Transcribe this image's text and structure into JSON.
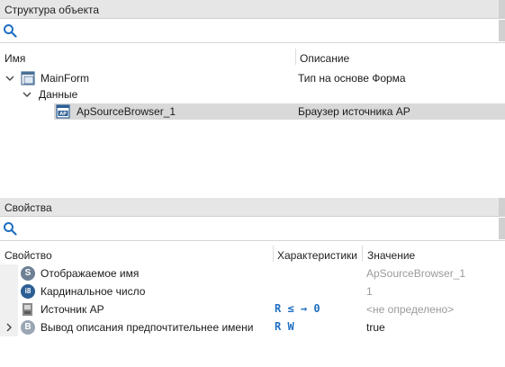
{
  "structure_panel": {
    "title": "Структура объекта",
    "search_value": "",
    "columns": {
      "name": "Имя",
      "description": "Описание"
    },
    "tree": [
      {
        "label": "MainForm",
        "description": "Тип на основе Форма",
        "icon": "form-icon",
        "expanded": true
      },
      {
        "label": "Данные",
        "description": "",
        "icon": "",
        "expanded": true
      },
      {
        "label": "ApSourceBrowser_1",
        "description": "Браузер источника АР",
        "icon": "ap-browser-icon",
        "selected": true
      }
    ]
  },
  "properties_panel": {
    "title": "Свойства",
    "search_value": "",
    "columns": {
      "property": "Свойство",
      "characteristics": "Характеристики",
      "value": "Значение"
    },
    "rows": [
      {
        "icon": "string-type-icon",
        "icon_text": "S",
        "icon_color": "#6d7f93",
        "name": "Отображаемое имя",
        "characteristics": "",
        "value": "ApSourceBrowser_1",
        "value_muted": true
      },
      {
        "icon": "integer-type-icon",
        "icon_text": "i8",
        "icon_color": "#2d5f95",
        "name": "Кардинальное число",
        "characteristics": "",
        "value": "1",
        "value_muted": true
      },
      {
        "icon": "ap-source-icon",
        "icon_text": "",
        "icon_color": "#6b6b6b",
        "name": "Источник АР",
        "characteristics": "R ≤ → 0",
        "value": "<не определено>",
        "value_muted": true
      },
      {
        "icon": "boolean-type-icon",
        "icon_text": "B",
        "icon_color": "#9aa6b4",
        "name": "Вывод описания предпочтительнее имени",
        "characteristics": "R W",
        "value": "true",
        "value_muted": false,
        "expandable": true
      }
    ]
  },
  "colors": {
    "accent": "#1f6fc2",
    "header_bg": "#e6e6e6",
    "selected_row": "#d9d9d9"
  }
}
